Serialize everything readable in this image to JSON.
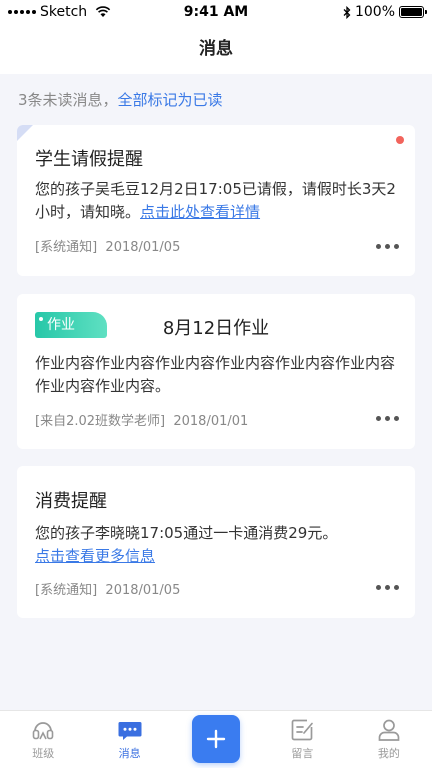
{
  "status_bar": {
    "carrier": "Sketch",
    "time": "9:41 AM",
    "battery": "100%"
  },
  "nav": {
    "title": "消息"
  },
  "notice": {
    "unread_text": "3条未读消息，",
    "mark_all_label": "全部标记为已读"
  },
  "messages": [
    {
      "title": "学生请假提醒",
      "body": "您的孩子吴毛豆12月2日17:05已请假，请假时长3天2小时，请知晓。",
      "link": "点击此处查看详情",
      "source": "[系统通知]",
      "date": "2018/01/05",
      "unread": true
    },
    {
      "tag": "作业",
      "title": "8月12日作业",
      "body": "作业内容作业内容作业内容作业内容作业内容作业内容作业内容作业内容。",
      "source": "[来自2.02班数学老师]",
      "date": "2018/01/01"
    },
    {
      "title": "消费提醒",
      "body": "您的孩子李晓晓17:05通过一卡通消费29元。",
      "link": "点击查看更多信息",
      "source": "[系统通知]",
      "date": "2018/01/05"
    }
  ],
  "tabs": [
    {
      "label": "班级",
      "icon": "class-icon",
      "active": false
    },
    {
      "label": "消息",
      "icon": "message-icon",
      "active": true
    },
    {
      "label": "",
      "icon": "plus-icon",
      "active": false
    },
    {
      "label": "留言",
      "icon": "note-icon",
      "active": false
    },
    {
      "label": "我的",
      "icon": "profile-icon",
      "active": false
    }
  ],
  "colors": {
    "accent": "#3a7cf0",
    "link": "#3a79e6",
    "unread_dot": "#f2645c",
    "tag_green": "#27c7a8",
    "background": "#f4f5fa"
  }
}
